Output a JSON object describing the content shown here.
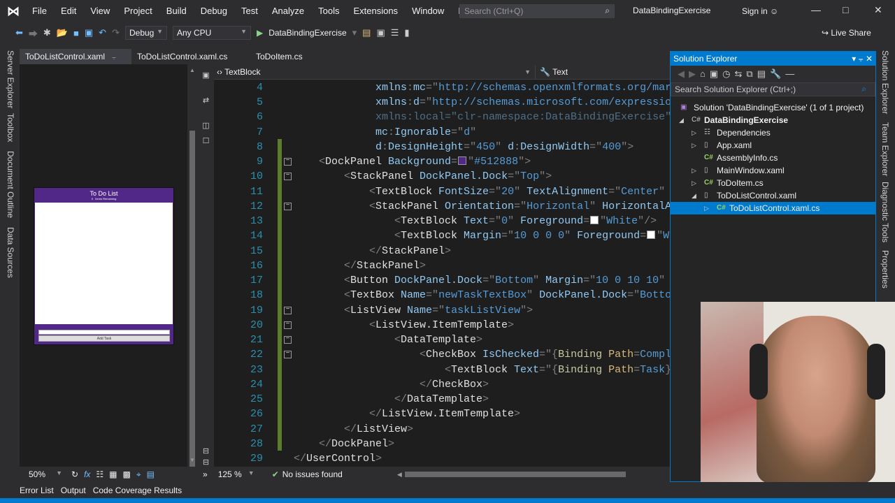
{
  "titlebar": {
    "menu": [
      "File",
      "Edit",
      "View",
      "Project",
      "Build",
      "Debug",
      "Test",
      "Analyze",
      "Tools",
      "Extensions",
      "Window",
      "Help"
    ],
    "search_placeholder": "Search (Ctrl+Q)",
    "title": "DataBindingExercise",
    "sign_in": "Sign in"
  },
  "toolbar": {
    "configuration": "Debug",
    "platform": "Any CPU",
    "start_target": "DataBindingExercise",
    "live_share": "Live Share"
  },
  "left_tabs": [
    "Server Explorer",
    "Toolbox",
    "Document Outline",
    "Data Sources"
  ],
  "doc_tabs": [
    "ToDoListControl.xaml",
    "ToDoListControl.xaml.cs",
    "ToDoItem.cs"
  ],
  "designer": {
    "preview_title": "To Do List",
    "preview_count": "0",
    "preview_remaining": "Items Remaining",
    "preview_button": "Add Task",
    "preview_bg": "#512888",
    "zoom": "50%"
  },
  "navbar": {
    "element": "TextBlock",
    "member": "Text"
  },
  "code": {
    "lines": [
      {
        "n": "4",
        "indent": 13,
        "tokens": [
          [
            "a",
            "xmlns"
          ],
          [
            "p",
            ":"
          ],
          [
            "a",
            "mc"
          ],
          [
            "p",
            "=\""
          ],
          [
            "v",
            "http://schemas.openxmlformats.org/mar"
          ]
        ]
      },
      {
        "n": "5",
        "indent": 13,
        "tokens": [
          [
            "a",
            "xmlns"
          ],
          [
            "p",
            ":"
          ],
          [
            "a",
            "d"
          ],
          [
            "p",
            "=\""
          ],
          [
            "v",
            "http://schemas.microsoft.com/expressio"
          ]
        ]
      },
      {
        "n": "6",
        "indent": 13,
        "tokens": [
          [
            "d",
            "xmlns:local=\"clr-namespace:DataBindingExercise\""
          ]
        ]
      },
      {
        "n": "7",
        "indent": 13,
        "tokens": [
          [
            "a",
            "mc"
          ],
          [
            "p",
            ":"
          ],
          [
            "a",
            "Ignorable"
          ],
          [
            "p",
            "=\""
          ],
          [
            "v",
            "d"
          ],
          [
            "p",
            "\""
          ]
        ]
      },
      {
        "n": "8",
        "indent": 13,
        "tokens": [
          [
            "a",
            "d"
          ],
          [
            "p",
            ":"
          ],
          [
            "a",
            "DesignHeight"
          ],
          [
            "p",
            "=\""
          ],
          [
            "v",
            "450"
          ],
          [
            "p",
            "\" "
          ],
          [
            "a",
            "d"
          ],
          [
            "p",
            ":"
          ],
          [
            "a",
            "DesignWidth"
          ],
          [
            "p",
            "=\""
          ],
          [
            "v",
            "400"
          ],
          [
            "p",
            "\">"
          ]
        ]
      },
      {
        "n": "9",
        "indent": 4,
        "tokens": [
          [
            "p",
            "<"
          ],
          [
            "e",
            "DockPanel "
          ],
          [
            "a",
            "Background"
          ],
          [
            "p",
            "="
          ],
          [
            "s",
            "#512888"
          ],
          [
            "p",
            "\""
          ],
          [
            "v",
            "#512888"
          ],
          [
            "p",
            "\">"
          ]
        ]
      },
      {
        "n": "10",
        "indent": 8,
        "tokens": [
          [
            "p",
            "<"
          ],
          [
            "e",
            "StackPanel "
          ],
          [
            "a",
            "DockPanel.Dock"
          ],
          [
            "p",
            "=\""
          ],
          [
            "v",
            "Top"
          ],
          [
            "p",
            "\">"
          ]
        ]
      },
      {
        "n": "11",
        "indent": 12,
        "tokens": [
          [
            "p",
            "<"
          ],
          [
            "e",
            "TextBlock "
          ],
          [
            "a",
            "FontSize"
          ],
          [
            "p",
            "=\""
          ],
          [
            "v",
            "20"
          ],
          [
            "p",
            "\" "
          ],
          [
            "a",
            "TextAlignment"
          ],
          [
            "p",
            "=\""
          ],
          [
            "v",
            "Center"
          ],
          [
            "p",
            "\""
          ]
        ]
      },
      {
        "n": "12",
        "indent": 12,
        "tokens": [
          [
            "p",
            "<"
          ],
          [
            "e",
            "StackPanel "
          ],
          [
            "a",
            "Orientation"
          ],
          [
            "p",
            "=\""
          ],
          [
            "v",
            "Horizontal"
          ],
          [
            "p",
            "\" "
          ],
          [
            "a",
            "HorizontalA"
          ]
        ]
      },
      {
        "n": "13",
        "indent": 16,
        "tokens": [
          [
            "p",
            "<"
          ],
          [
            "e",
            "TextBlock "
          ],
          [
            "a",
            "Text"
          ],
          [
            "p",
            "=\""
          ],
          [
            "v",
            "0"
          ],
          [
            "p",
            "\" "
          ],
          [
            "a",
            "Foreground"
          ],
          [
            "p",
            "="
          ],
          [
            "s",
            "#ffffff"
          ],
          [
            "p",
            "\""
          ],
          [
            "v",
            "White"
          ],
          [
            "p",
            "\"/>"
          ]
        ]
      },
      {
        "n": "14",
        "indent": 16,
        "tokens": [
          [
            "p",
            "<"
          ],
          [
            "e",
            "TextBlock "
          ],
          [
            "a",
            "Margin"
          ],
          [
            "p",
            "=\""
          ],
          [
            "v",
            "10 0 0 0"
          ],
          [
            "p",
            "\" "
          ],
          [
            "a",
            "Foreground"
          ],
          [
            "p",
            "="
          ],
          [
            "s",
            "#ffffff"
          ],
          [
            "p",
            "\""
          ],
          [
            "v",
            "Wh"
          ]
        ]
      },
      {
        "n": "15",
        "indent": 12,
        "tokens": [
          [
            "p",
            "</"
          ],
          [
            "e",
            "StackPanel"
          ],
          [
            "p",
            ">"
          ]
        ]
      },
      {
        "n": "16",
        "indent": 8,
        "tokens": [
          [
            "p",
            "</"
          ],
          [
            "e",
            "StackPanel"
          ],
          [
            "p",
            ">"
          ]
        ]
      },
      {
        "n": "17",
        "indent": 8,
        "tokens": [
          [
            "p",
            "<"
          ],
          [
            "e",
            "Button "
          ],
          [
            "a",
            "DockPanel.Dock"
          ],
          [
            "p",
            "=\""
          ],
          [
            "v",
            "Bottom"
          ],
          [
            "p",
            "\" "
          ],
          [
            "a",
            "Margin"
          ],
          [
            "p",
            "=\""
          ],
          [
            "v",
            "10 0 10 10"
          ],
          [
            "p",
            "\""
          ]
        ]
      },
      {
        "n": "18",
        "indent": 8,
        "tokens": [
          [
            "p",
            "<"
          ],
          [
            "e",
            "TextBox "
          ],
          [
            "a",
            "Name"
          ],
          [
            "p",
            "=\""
          ],
          [
            "v",
            "newTaskTextBox"
          ],
          [
            "p",
            "\" "
          ],
          [
            "a",
            "DockPanel.Dock"
          ],
          [
            "p",
            "=\""
          ],
          [
            "v",
            "Botto"
          ]
        ]
      },
      {
        "n": "19",
        "indent": 8,
        "tokens": [
          [
            "p",
            "<"
          ],
          [
            "e",
            "ListView "
          ],
          [
            "a",
            "Name"
          ],
          [
            "p",
            "=\""
          ],
          [
            "v",
            "taskListView"
          ],
          [
            "p",
            "\">"
          ]
        ]
      },
      {
        "n": "20",
        "indent": 12,
        "tokens": [
          [
            "p",
            "<"
          ],
          [
            "e",
            "ListView.ItemTemplate"
          ],
          [
            "p",
            ">"
          ]
        ]
      },
      {
        "n": "21",
        "indent": 16,
        "tokens": [
          [
            "p",
            "<"
          ],
          [
            "e",
            "DataTemplate"
          ],
          [
            "p",
            ">"
          ]
        ]
      },
      {
        "n": "22",
        "indent": 20,
        "tokens": [
          [
            "p",
            "<"
          ],
          [
            "e",
            "CheckBox "
          ],
          [
            "a",
            "IsChecked"
          ],
          [
            "p",
            "=\"{"
          ],
          [
            "b",
            "Binding "
          ],
          [
            "y",
            "Path"
          ],
          [
            "p",
            "="
          ],
          [
            "v",
            "Compl"
          ]
        ]
      },
      {
        "n": "23",
        "indent": 24,
        "tokens": [
          [
            "p",
            "<"
          ],
          [
            "e",
            "TextBlock "
          ],
          [
            "a",
            "Text"
          ],
          [
            "p",
            "=\"{"
          ],
          [
            "b",
            "Binding "
          ],
          [
            "y",
            "Path"
          ],
          [
            "p",
            "="
          ],
          [
            "v",
            "Task"
          ],
          [
            "p",
            "}"
          ]
        ]
      },
      {
        "n": "24",
        "indent": 20,
        "tokens": [
          [
            "p",
            "</"
          ],
          [
            "e",
            "CheckBox"
          ],
          [
            "p",
            ">"
          ]
        ]
      },
      {
        "n": "25",
        "indent": 16,
        "tokens": [
          [
            "p",
            "</"
          ],
          [
            "e",
            "DataTemplate"
          ],
          [
            "p",
            ">"
          ]
        ]
      },
      {
        "n": "26",
        "indent": 12,
        "tokens": [
          [
            "p",
            "</"
          ],
          [
            "e",
            "ListView.ItemTemplate"
          ],
          [
            "p",
            ">"
          ]
        ]
      },
      {
        "n": "27",
        "indent": 8,
        "tokens": [
          [
            "p",
            "</"
          ],
          [
            "e",
            "ListView"
          ],
          [
            "p",
            ">"
          ]
        ]
      },
      {
        "n": "28",
        "indent": 4,
        "tokens": [
          [
            "p",
            "</"
          ],
          [
            "e",
            "DockPanel"
          ],
          [
            "p",
            ">"
          ]
        ]
      },
      {
        "n": "29",
        "indent": 0,
        "tokens": [
          [
            "p",
            "</"
          ],
          [
            "e",
            "UserControl"
          ],
          [
            "p",
            ">"
          ]
        ]
      }
    ]
  },
  "editor_status": {
    "zoom": "125 %",
    "issues": "No issues found"
  },
  "bottom_tabs": [
    "Error List",
    "Output",
    "Code Coverage Results"
  ],
  "solution_explorer": {
    "title": "Solution Explorer",
    "search_placeholder": "Search Solution Explorer (Ctrl+;)",
    "nodes": [
      {
        "label": "Solution 'DataBindingExercise' (1 of 1 project)",
        "icon": "solution-icon"
      },
      {
        "label": "DataBindingExercise",
        "icon": "csharp-project-icon"
      },
      {
        "label": "Dependencies",
        "icon": "dependencies-icon"
      },
      {
        "label": "App.xaml",
        "icon": "xaml-file-icon"
      },
      {
        "label": "AssemblyInfo.cs",
        "icon": "csharp-file-icon"
      },
      {
        "label": "MainWindow.xaml",
        "icon": "xaml-file-icon"
      },
      {
        "label": "ToDoItem.cs",
        "icon": "csharp-file-icon"
      },
      {
        "label": "ToDoListControl.xaml",
        "icon": "xaml-file-icon"
      },
      {
        "label": "ToDoListControl.xaml.cs",
        "icon": "csharp-file-icon",
        "selected": true
      }
    ]
  },
  "right_tabs": [
    "Solution Explorer",
    "Team Explorer",
    "Diagnostic Tools",
    "Properties"
  ],
  "colors": {
    "accent": "#007acc",
    "background": "#1e1e1e",
    "chrome": "#2d2d30"
  }
}
